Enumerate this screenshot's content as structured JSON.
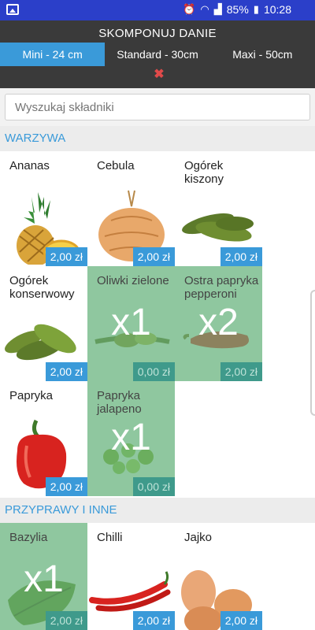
{
  "status": {
    "battery": "85%",
    "time": "10:28"
  },
  "header": {
    "title": "SKOMPONUJ DANIE",
    "sizes": [
      {
        "label": "Mini - 24 cm",
        "active": true
      },
      {
        "label": "Standard - 30cm",
        "active": false
      },
      {
        "label": "Maxi - 50cm",
        "active": false
      }
    ],
    "close_icon": "close-icon"
  },
  "search": {
    "placeholder": "Wyszukaj składniki"
  },
  "sections": [
    {
      "title": "WARZYWA",
      "items": [
        {
          "name": "Ananas",
          "price": "2,00 zł",
          "selected": false,
          "qty": "",
          "icon": "pineapple"
        },
        {
          "name": "Cebula",
          "price": "2,00 zł",
          "selected": false,
          "qty": "",
          "icon": "onion"
        },
        {
          "name": "Ogórek kiszony",
          "price": "2,00 zł",
          "selected": false,
          "qty": "",
          "icon": "pickles"
        },
        {
          "name": "Ogórek konserwowy",
          "price": "2,00 zł",
          "selected": false,
          "qty": "",
          "icon": "pickles"
        },
        {
          "name": "Oliwki zielone",
          "price": "0,00 zł",
          "selected": true,
          "qty": "x1",
          "icon": "olives"
        },
        {
          "name": "Ostra papryka pepperoni",
          "price": "2,00 zł",
          "selected": true,
          "qty": "x2",
          "icon": "pepperoni"
        },
        {
          "name": "Papryka",
          "price": "2,00 zł",
          "selected": false,
          "qty": "",
          "icon": "bell-pepper"
        },
        {
          "name": "Papryka jalapeno",
          "price": "0,00 zł",
          "selected": true,
          "qty": "x1",
          "icon": "jalapeno"
        }
      ]
    },
    {
      "title": "PRZYPRAWY I INNE",
      "items": [
        {
          "name": "Bazylia",
          "price": "2,00 zł",
          "selected": true,
          "qty": "x1",
          "icon": "basil"
        },
        {
          "name": "Chilli",
          "price": "2,00 zł",
          "selected": false,
          "qty": "",
          "icon": "chilli"
        },
        {
          "name": "Jajko",
          "price": "2,00 zł",
          "selected": false,
          "qty": "",
          "icon": "eggs"
        }
      ]
    }
  ],
  "colors": {
    "accent": "#3a9ad9",
    "statusbar": "#2b3fc9",
    "topbar": "#3a3a3a",
    "selected": "#8fc79f",
    "close": "#e04a4a"
  }
}
